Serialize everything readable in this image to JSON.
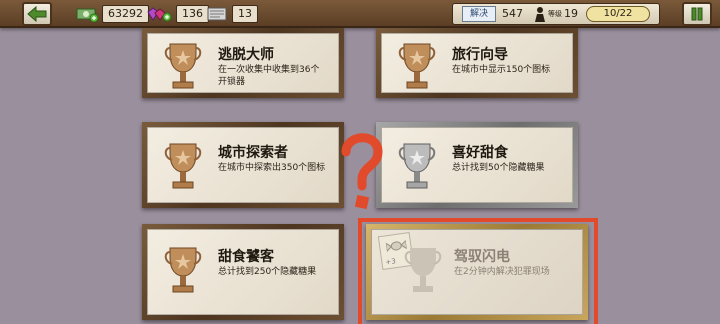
{
  "topbar": {
    "cash": "63292",
    "gems": "136",
    "items": "13",
    "ticket_label": "解决",
    "cases": "547",
    "level_label": "等级",
    "level": "19",
    "progress": "10/22"
  },
  "achievements": [
    {
      "title": "逃脱大师",
      "desc": "在一次收集中收集到36个开锁器",
      "tier": "bronze"
    },
    {
      "title": "旅行向导",
      "desc": "在城市中显示150个图标",
      "tier": "bronze"
    },
    {
      "title": "城市探索者",
      "desc": "在城市中探索出350个图标",
      "tier": "bronze"
    },
    {
      "title": "喜好甜食",
      "desc": "总计找到50个隐藏糖果",
      "tier": "silver"
    },
    {
      "title": "甜食饕客",
      "desc": "总计找到250个隐藏糖果",
      "tier": "bronze"
    },
    {
      "title": "驾驭闪电",
      "desc": "在2分钟内解决犯罪现场",
      "tier": "locked"
    }
  ],
  "locked_reward": "+3",
  "colors": {
    "background": "#9a8f9d",
    "highlight": "#e24a2c",
    "question_mark": "#e24a2c",
    "topbar": "#6a4c2f"
  }
}
